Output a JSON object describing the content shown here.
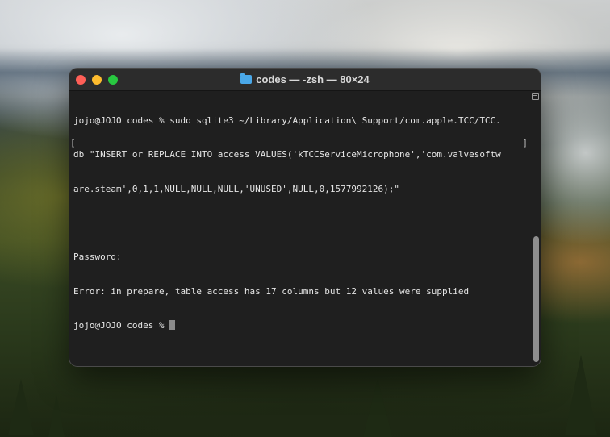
{
  "window": {
    "title": "codes — -zsh — 80×24",
    "title_icon": "folder-icon",
    "traffic_lights": {
      "close": "#ff5f57",
      "minimize": "#febc2e",
      "maximize": "#28c840"
    }
  },
  "terminal": {
    "lines": [
      "jojo@JOJO codes % sudo sqlite3 ~/Library/Application\\ Support/com.apple.TCC/TCC.",
      "db \"INSERT or REPLACE INTO access VALUES('kTCCServiceMicrophone','com.valvesoftw",
      "are.steam',0,1,1,NULL,NULL,NULL,'UNUSED',NULL,0,1577992126);\"",
      "",
      "Password:",
      "Error: in prepare, table access has 17 columns but 12 values were supplied"
    ],
    "prompt": "jojo@JOJO codes % ",
    "bracket_left": "[",
    "bracket_right": "]",
    "scroll_position": 0.55
  }
}
